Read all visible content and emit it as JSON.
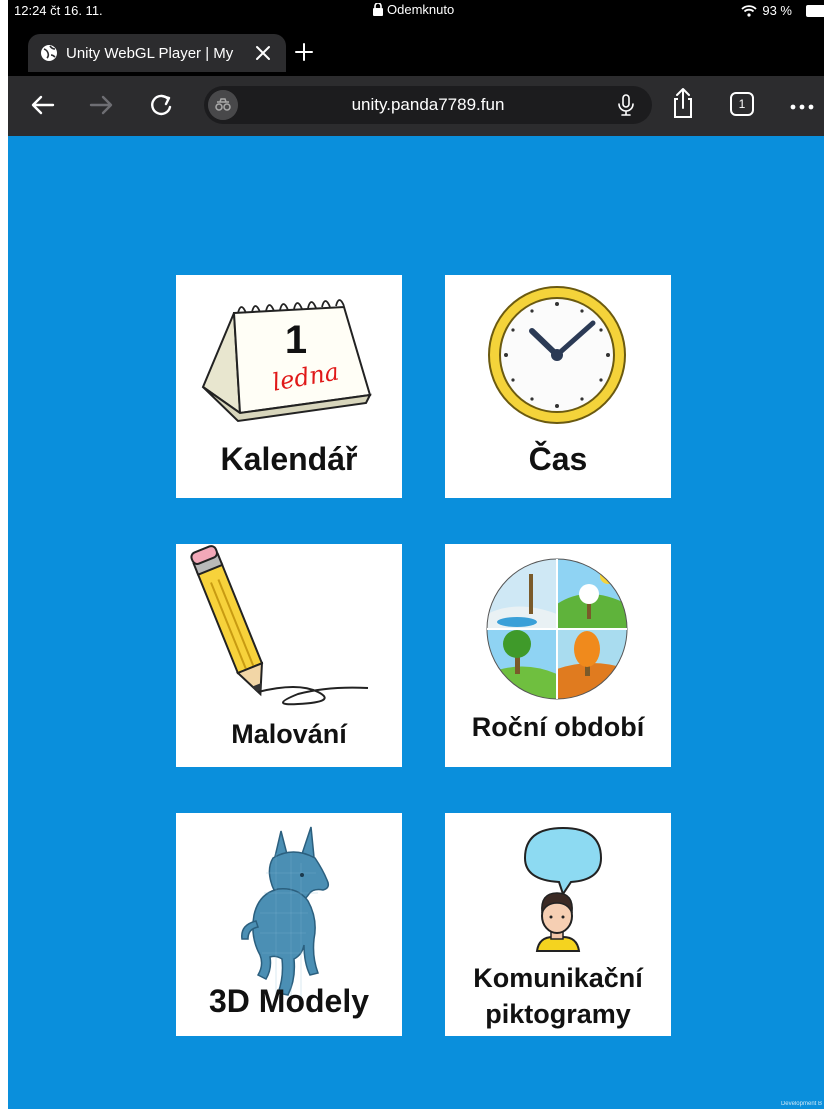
{
  "status_bar": {
    "time": "12:24  čt 16. 11.",
    "lock_label": "Odemknuto",
    "battery": "93 %"
  },
  "tab": {
    "title": "Unity WebGL Player | My"
  },
  "toolbar": {
    "url": "unity.panda7789.fun",
    "tabs_count": "1"
  },
  "menu": {
    "tiles": [
      {
        "label": "Kalendář",
        "icon": "calendar-icon"
      },
      {
        "label": "Čas",
        "icon": "clock-icon"
      },
      {
        "label": "Malování",
        "icon": "pencil-icon"
      },
      {
        "label": "Roční období",
        "icon": "seasons-icon"
      },
      {
        "label": "3D Modely",
        "icon": "dog-3d-model-icon"
      },
      {
        "label_line1": "Komunikační",
        "label_line2": "piktogramy",
        "icon": "speech-person-icon"
      }
    ],
    "calendar_number": "1",
    "calendar_word": "ledna"
  },
  "footer": {
    "dev_text": "Development B"
  },
  "colors": {
    "background": "#0a8fdc",
    "tile": "#ffffff"
  }
}
